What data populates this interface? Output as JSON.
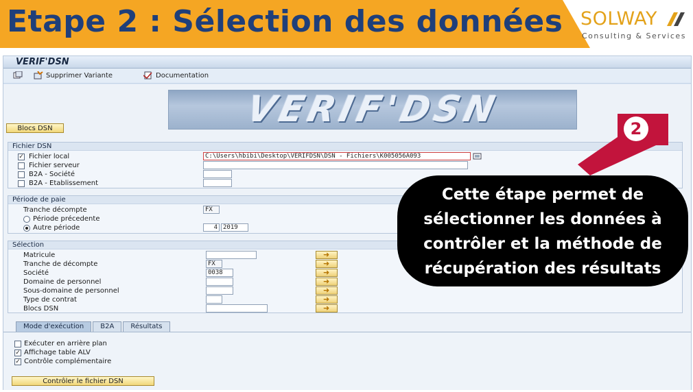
{
  "slide": {
    "title": "Etape 2 : Sélection des données",
    "logo_name": "SOLWAY",
    "logo_tagline": "Consulting & Services",
    "colors": {
      "banner": "#f5a623",
      "title": "#1f3f7a",
      "accent": "#c2143c",
      "logo": "#e3a21a"
    }
  },
  "sap": {
    "window_title": "VERIF'DSN",
    "toolbar": {
      "delete_variant": "Supprimer Variante",
      "documentation": "Documentation"
    },
    "banner_image_text": "VERIF'DSN",
    "blocs_dsn_button": "Blocs DSN",
    "fichier_dsn": {
      "header": "Fichier DSN",
      "options": [
        {
          "label": "Fichier local",
          "checked": true
        },
        {
          "label": "Fichier serveur",
          "checked": false
        },
        {
          "label": "B2A - Société",
          "checked": false
        },
        {
          "label": "B2A - Etablissement",
          "checked": false
        }
      ],
      "local_path": "C:\\Users\\hbibi\\Desktop\\VERIFDSN\\DSN - Fichiers\\K005056A093"
    },
    "periode": {
      "header": "Période de paie",
      "tranche_label": "Tranche décompte",
      "tranche_value": "FX",
      "precedente_label": "Période précedente",
      "autre_label": "Autre période",
      "autre_selected": true,
      "period_month": "4",
      "period_year": "2019"
    },
    "selection": {
      "header": "Sélection",
      "rows": [
        {
          "label": "Matricule",
          "value": ""
        },
        {
          "label": "Tranche de décompte",
          "value": "FX"
        },
        {
          "label": "Société",
          "value": "0038"
        },
        {
          "label": "Domaine de personnel",
          "value": ""
        },
        {
          "label": "Sous-domaine de personnel",
          "value": ""
        },
        {
          "label": "Type de contrat",
          "value": ""
        },
        {
          "label": "Blocs DSN",
          "value": ""
        }
      ]
    },
    "tabs": [
      {
        "label": "Mode d'exécution",
        "active": true
      },
      {
        "label": "B2A",
        "active": false
      },
      {
        "label": "Résultats",
        "active": false
      }
    ],
    "exec_options": [
      {
        "label": "Exécuter en arrière plan",
        "checked": false
      },
      {
        "label": "Affichage table ALV",
        "checked": true
      },
      {
        "label": "Contrôle complémentaire",
        "checked": true
      }
    ],
    "execute_button": "Contrôler le fichier DSN"
  },
  "callout": {
    "badge": "2",
    "lines": [
      "Cette étape permet de",
      "sélectionner les données à",
      "contrôler et la méthode de",
      "récupération des résultats"
    ]
  }
}
